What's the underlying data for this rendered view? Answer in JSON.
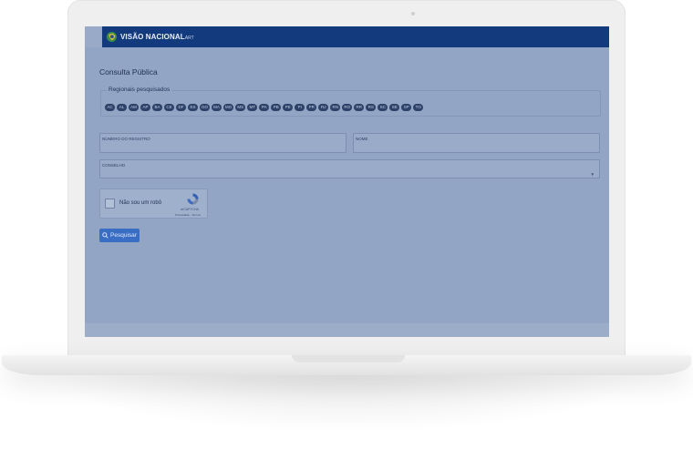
{
  "header": {
    "brand": "VISÃO NACIONAL",
    "brand_suffix": "ART"
  },
  "page": {
    "title": "Consulta Pública"
  },
  "regionais": {
    "legend": "Regionais pesquisados",
    "chips": [
      "AC",
      "AL",
      "AM",
      "AP",
      "BA",
      "CE",
      "DF",
      "ES",
      "GO",
      "MA",
      "MG",
      "MS",
      "MT",
      "PA",
      "PB",
      "PE",
      "PI",
      "PR",
      "RJ",
      "RN",
      "RO",
      "RR",
      "RS",
      "SC",
      "SE",
      "SP",
      "TO"
    ]
  },
  "form": {
    "numero_registro_label": "NÚMERO DO REGISTRO",
    "nome_label": "NOME",
    "conselho_label": "CONSELHO"
  },
  "captcha": {
    "label": "Não sou um robô",
    "brand": "reCAPTCHA",
    "links": "Privacidade - Termos"
  },
  "search_button": {
    "label": "Pesquisar",
    "icon": "search-icon"
  }
}
